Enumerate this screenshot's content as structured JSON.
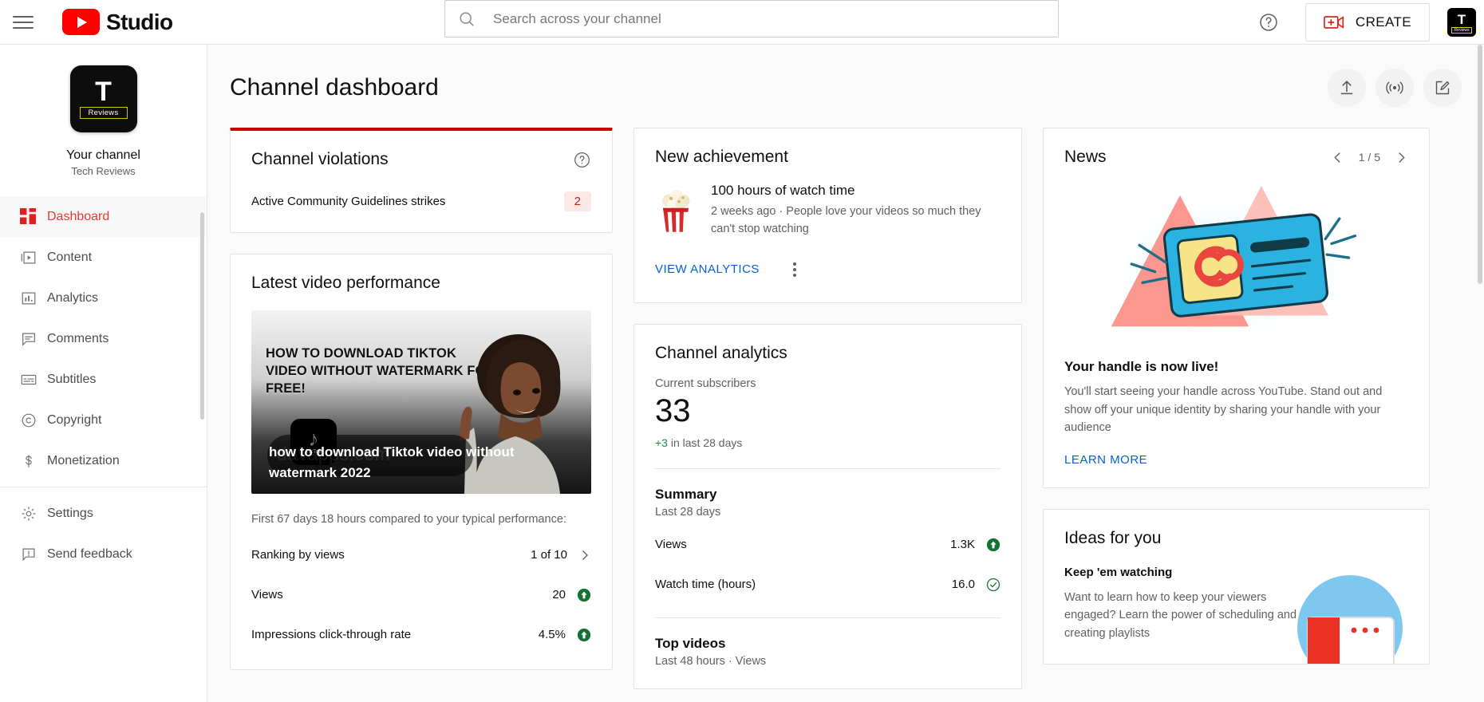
{
  "topbar": {
    "menu_icon": "hamburger-icon",
    "brand": "Studio",
    "search": {
      "placeholder": "Search across your channel",
      "value": ""
    },
    "help_icon": "help-circle-icon",
    "create_label": "CREATE",
    "create_icon": "video-plus-icon",
    "avatar_letter": "T",
    "avatar_sub": "Reviews"
  },
  "sidebar": {
    "avatar_letter": "T",
    "avatar_sub": "Reviews",
    "channel_label": "Your channel",
    "channel_name": "Tech Reviews",
    "items": [
      {
        "label": "Dashboard",
        "icon": "dashboard-icon",
        "active": true
      },
      {
        "label": "Content",
        "icon": "content-play-icon",
        "active": false
      },
      {
        "label": "Analytics",
        "icon": "analytics-bar-icon",
        "active": false
      },
      {
        "label": "Comments",
        "icon": "comment-icon",
        "active": false
      },
      {
        "label": "Subtitles",
        "icon": "subtitles-icon",
        "active": false
      },
      {
        "label": "Copyright",
        "icon": "copyright-icon",
        "active": false
      },
      {
        "label": "Monetization",
        "icon": "dollar-icon",
        "active": false
      },
      {
        "label": "Settings",
        "icon": "gear-icon",
        "active": false
      },
      {
        "label": "Send feedback",
        "icon": "feedback-icon",
        "active": false
      }
    ]
  },
  "header": {
    "title": "Channel dashboard",
    "actions": [
      {
        "name": "upload-video-button",
        "icon": "upload-icon"
      },
      {
        "name": "go-live-button",
        "icon": "live-broadcast-icon"
      },
      {
        "name": "create-post-button",
        "icon": "edit-square-icon"
      }
    ]
  },
  "violations": {
    "title": "Channel violations",
    "help_icon": "help-circle-icon",
    "row_label": "Active Community Guidelines strikes",
    "row_value": "2",
    "accent_color": "#cc0000",
    "badge_bg": "#fce8e6",
    "badge_color": "#c5221f"
  },
  "latest_video": {
    "title": "Latest video performance",
    "thumbnail_title": "HOW TO DOWNLOAD TIKTOK VIDEO WITHOUT WATERMARK FOR FREE!",
    "thumbnail_brand": "TikTok",
    "thumbnail_note": "♪",
    "watermark": "davapps.com",
    "video_title": "how to download Tiktok video without watermark 2022",
    "note": "First 67 days 18 hours compared to your typical performance:",
    "metrics": [
      {
        "label": "Ranking by views",
        "value": "1 of 10",
        "indicator": "chevron-right-icon"
      },
      {
        "label": "Views",
        "value": "20",
        "indicator": "arrow-up-filled-icon"
      },
      {
        "label": "Impressions click-through rate",
        "value": "4.5%",
        "indicator": "arrow-up-filled-icon"
      }
    ]
  },
  "achievement": {
    "title": "New achievement",
    "icon": "popcorn-icon",
    "headline": "100 hours of watch time",
    "description": "2 weeks ago · People love your videos so much they can't stop watching",
    "action_label": "VIEW ANALYTICS",
    "menu_icon": "kebab-menu-icon"
  },
  "analytics": {
    "title": "Channel analytics",
    "subscribers_label": "Current subscribers",
    "subscribers_value": "33",
    "delta_value": "+3",
    "delta_rest": " in last 28 days",
    "summary_title": "Summary",
    "summary_sub": "Last 28 days",
    "summary_rows": [
      {
        "label": "Views",
        "value": "1.3K",
        "indicator": "arrow-up-filled-icon"
      },
      {
        "label": "Watch time (hours)",
        "value": "16.0",
        "indicator": "check-circle-icon"
      }
    ],
    "top_videos_title": "Top videos",
    "top_videos_sub": "Last 48 hours · Views"
  },
  "news": {
    "title": "News",
    "page_indicator": "1 / 5",
    "prev_icon": "chevron-left-icon",
    "next_icon": "chevron-right-icon",
    "illustration": "email-card-illustration",
    "headline": "Your handle is now live!",
    "body": "You'll start seeing your handle across YouTube. Stand out and show off your unique identity by sharing your handle with your audience",
    "action_label": "LEARN MORE"
  },
  "ideas": {
    "title": "Ideas for you",
    "headline": "Keep 'em watching",
    "body": "Want to learn how to keep your viewers engaged? Learn the power of scheduling and creating playlists",
    "illustration": "playlist-illustration"
  },
  "colors": {
    "brand_red": "#ff0000",
    "link_blue": "#065fd4",
    "positive_green": "#1e8e3e",
    "page_bg": "#fafafa"
  }
}
